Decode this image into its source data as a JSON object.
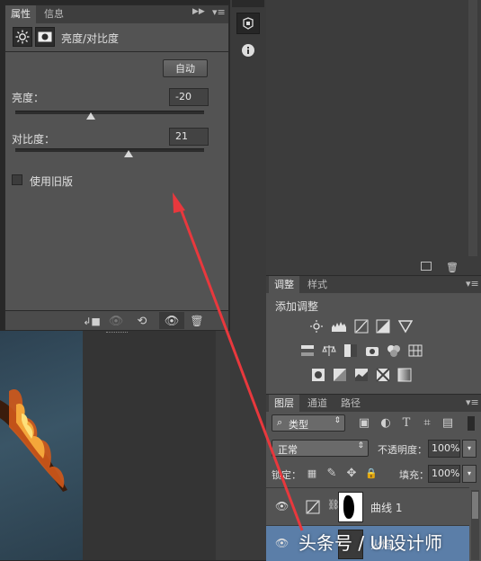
{
  "props_panel": {
    "tabs": [
      {
        "label": "属性"
      },
      {
        "label": "信息"
      }
    ],
    "title": "亮度/对比度",
    "auto_button": "自动",
    "brightness": {
      "label": "亮度：",
      "value": "-20",
      "slider_fraction": 0.4
    },
    "contrast": {
      "label": "对比度：",
      "value": "21",
      "slider_fraction": 0.6
    },
    "legacy_checkbox": {
      "label": "使用旧版",
      "checked": false
    }
  },
  "adjust_panel": {
    "tabs": [
      {
        "label": "调整"
      },
      {
        "label": "样式"
      }
    ],
    "add_label": "添加调整",
    "rows": [
      [
        "brightness-contrast-icon",
        "levels-icon",
        "curves-icon",
        "exposure-icon",
        "vibrance-icon"
      ],
      [
        "hue-saturation-icon",
        "color-balance-icon",
        "black-white-icon",
        "photo-filter-icon",
        "channel-mixer-icon",
        "color-lookup-icon"
      ],
      [
        "invert-icon",
        "posterize-icon",
        "threshold-icon",
        "selective-color-icon",
        "gradient-map-icon"
      ]
    ]
  },
  "layers_panel": {
    "tabs": [
      {
        "label": "图层"
      },
      {
        "label": "通道"
      },
      {
        "label": "路径"
      }
    ],
    "filter_label": "类型",
    "blend_mode": "正常",
    "opacity_label": "不透明度：",
    "opacity_value": "100%",
    "lock_label": "锁定：",
    "fill_label": "填充：",
    "fill_value": "100%",
    "layers": [
      {
        "name": "曲线 1",
        "selected": false
      },
      {
        "name": "火焰",
        "selected": true
      }
    ]
  },
  "watermark": "头条号 / UI设计师",
  "colors": {
    "panel": "#535353",
    "dark": "#282828",
    "accent_red": "#e8383d",
    "selected": "#5b7ea8"
  }
}
